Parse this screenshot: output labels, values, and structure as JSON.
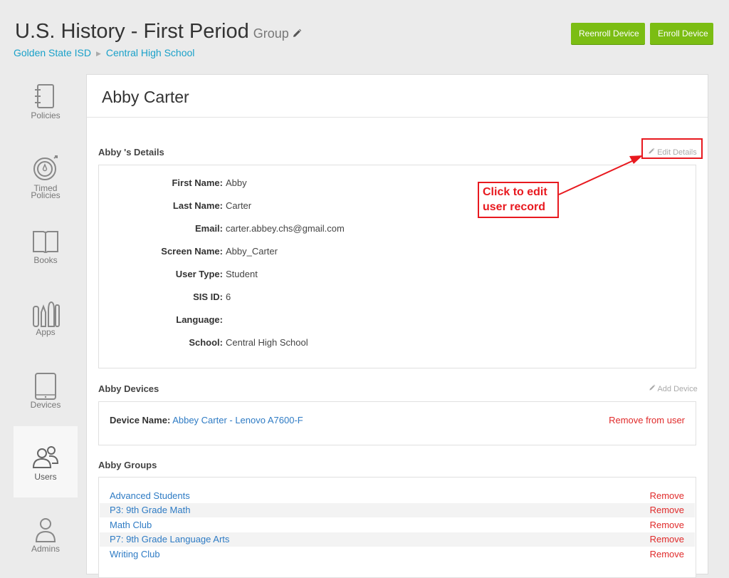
{
  "header": {
    "title": "U.S. History - First Period",
    "subtitle": "Group",
    "breadcrumb": [
      "Golden State ISD",
      "Central High School"
    ],
    "reenroll_label": "Reenroll Device",
    "enroll_label": "Enroll Device"
  },
  "sidebar": {
    "items": [
      {
        "label": "Policies",
        "icon": "notebook-icon"
      },
      {
        "label": "Timed",
        "label2": "Policies",
        "icon": "stopwatch-icon"
      },
      {
        "label": "Books",
        "icon": "book-icon"
      },
      {
        "label": "Apps",
        "icon": "tools-icon"
      },
      {
        "label": "Devices",
        "icon": "tablet-icon"
      },
      {
        "label": "Users",
        "icon": "users-icon"
      },
      {
        "label": "Admins",
        "icon": "admin-icon"
      }
    ]
  },
  "user": {
    "name": "Abby Carter"
  },
  "details": {
    "title": "Abby 's Details",
    "edit_label": "Edit Details",
    "rows": [
      {
        "key": "First Name:",
        "value": "Abby"
      },
      {
        "key": "Last Name:",
        "value": "Carter"
      },
      {
        "key": "Email:",
        "value": "carter.abbey.chs@gmail.com"
      },
      {
        "key": "Screen Name:",
        "value": "Abby_Carter"
      },
      {
        "key": "User Type:",
        "value": "Student"
      },
      {
        "key": "SIS ID:",
        "value": "6"
      },
      {
        "key": "Language:",
        "value": ""
      },
      {
        "key": "School:",
        "value": "Central High School"
      }
    ]
  },
  "devices": {
    "title": "Abby Devices",
    "add_label": "Add Device",
    "device_key": "Device Name:",
    "device_value": "Abbey Carter - Lenovo A7600-F",
    "remove_label": "Remove from user"
  },
  "groups": {
    "title": "Abby Groups",
    "remove_label": "Remove",
    "items": [
      "Advanced Students",
      "P3: 9th Grade Math",
      "Math Club",
      "P7: 9th Grade Language Arts",
      "Writing Club"
    ]
  },
  "annotation": {
    "line1": "Click to edit",
    "line2": "user record"
  },
  "colors": {
    "accent_green": "#7bbd13",
    "link_blue": "#2e7bc4",
    "breadcrumb_cyan": "#1aa1c9",
    "remove_red": "#e02a2a",
    "annotation_red": "#e8191f"
  }
}
